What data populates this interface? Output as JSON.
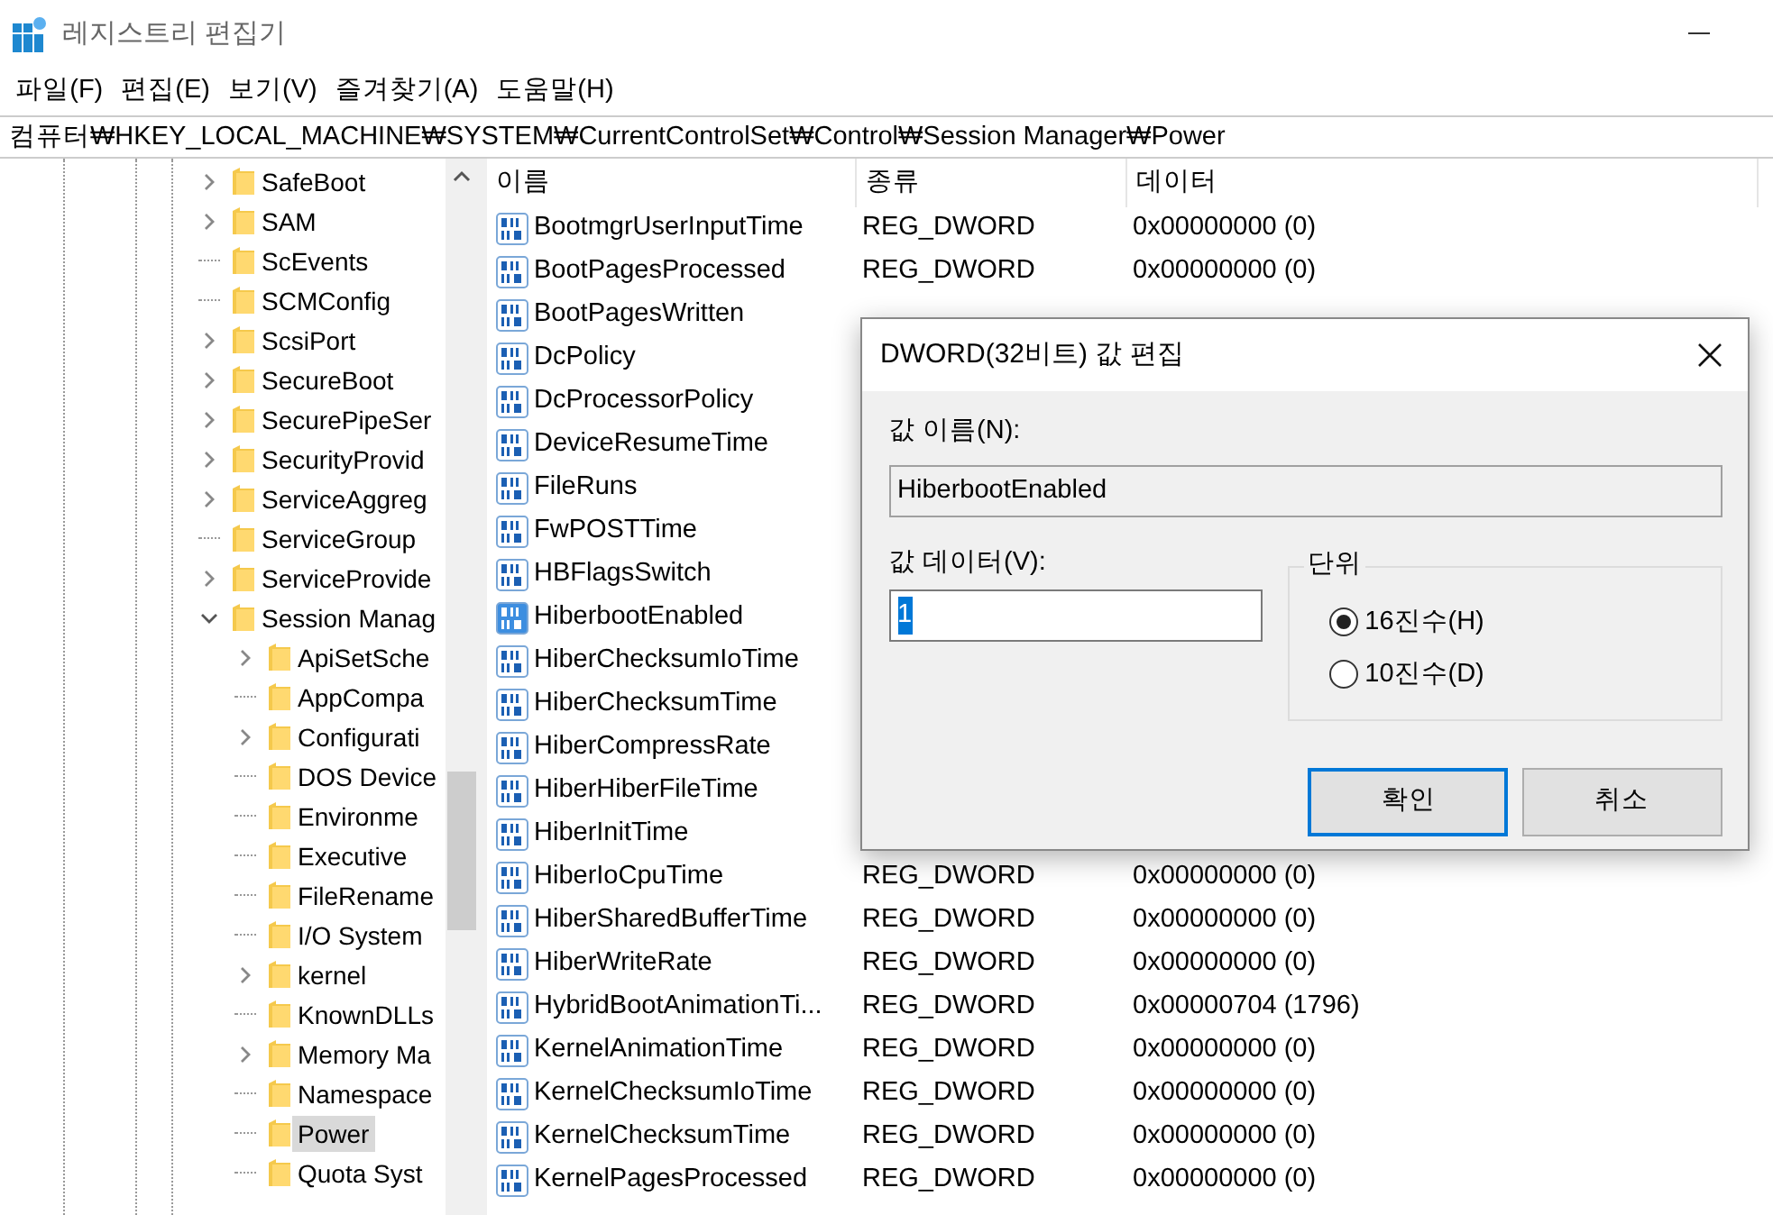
{
  "window": {
    "title": "레지스트리 편집기"
  },
  "menu": [
    "파일(F)",
    "편집(E)",
    "보기(V)",
    "즐겨찾기(A)",
    "도움말(H)"
  ],
  "address": "컴퓨터₩HKEY_LOCAL_MACHINE₩SYSTEM₩CurrentControlSet₩Control₩Session Manager₩Power",
  "tree": [
    {
      "label": "SafeBoot",
      "expandable": true,
      "expanded": false,
      "selected": false
    },
    {
      "label": "SAM",
      "expandable": true,
      "expanded": false,
      "selected": false
    },
    {
      "label": "ScEvents",
      "expandable": false,
      "selected": false
    },
    {
      "label": "SCMConfig",
      "expandable": false,
      "selected": false
    },
    {
      "label": "ScsiPort",
      "expandable": true,
      "expanded": false,
      "selected": false
    },
    {
      "label": "SecureBoot",
      "expandable": true,
      "expanded": false,
      "selected": false
    },
    {
      "label": "SecurePipeSer",
      "expandable": true,
      "expanded": false,
      "selected": false
    },
    {
      "label": "SecurityProvid",
      "expandable": true,
      "expanded": false,
      "selected": false
    },
    {
      "label": "ServiceAggreg",
      "expandable": true,
      "expanded": false,
      "selected": false
    },
    {
      "label": "ServiceGroup",
      "expandable": false,
      "selected": false
    },
    {
      "label": "ServiceProvide",
      "expandable": true,
      "expanded": false,
      "selected": false
    },
    {
      "label": "Session Manag",
      "expandable": true,
      "expanded": true,
      "selected": false,
      "children": [
        {
          "label": "ApiSetSche",
          "expandable": true,
          "expanded": false,
          "selected": false
        },
        {
          "label": "AppCompa",
          "expandable": false,
          "selected": false
        },
        {
          "label": "Configurati",
          "expandable": true,
          "expanded": false,
          "selected": false
        },
        {
          "label": "DOS Device",
          "expandable": false,
          "selected": false
        },
        {
          "label": "Environme",
          "expandable": false,
          "selected": false
        },
        {
          "label": "Executive",
          "expandable": false,
          "selected": false
        },
        {
          "label": "FileRename",
          "expandable": false,
          "selected": false
        },
        {
          "label": "I/O System",
          "expandable": false,
          "selected": false
        },
        {
          "label": "kernel",
          "expandable": true,
          "expanded": false,
          "selected": false
        },
        {
          "label": "KnownDLLs",
          "expandable": false,
          "selected": false
        },
        {
          "label": "Memory Ma",
          "expandable": true,
          "expanded": false,
          "selected": false
        },
        {
          "label": "Namespace",
          "expandable": false,
          "selected": false
        },
        {
          "label": "Power",
          "expandable": false,
          "selected": true
        },
        {
          "label": "Quota Syst",
          "expandable": false,
          "selected": false
        }
      ]
    }
  ],
  "table": {
    "columns": [
      "이름",
      "종류",
      "데이터"
    ],
    "rows": [
      {
        "name": "BootmgrUserInputTime",
        "type": "REG_DWORD",
        "data": "0x00000000 (0)",
        "selected": false
      },
      {
        "name": "BootPagesProcessed",
        "type": "REG_DWORD",
        "data": "0x00000000 (0)",
        "selected": false
      },
      {
        "name": "BootPagesWritten",
        "selected": false
      },
      {
        "name": "DcPolicy",
        "selected": false
      },
      {
        "name": "DcProcessorPolicy",
        "selected": false
      },
      {
        "name": "DeviceResumeTime",
        "selected": false
      },
      {
        "name": "FileRuns",
        "selected": false
      },
      {
        "name": "FwPOSTTime",
        "selected": false
      },
      {
        "name": "HBFlagsSwitch",
        "selected": false
      },
      {
        "name": "HiberbootEnabled",
        "selected": true
      },
      {
        "name": "HiberChecksumIoTime",
        "selected": false
      },
      {
        "name": "HiberChecksumTime",
        "selected": false
      },
      {
        "name": "HiberCompressRate",
        "selected": false
      },
      {
        "name": "HiberHiberFileTime",
        "selected": false
      },
      {
        "name": "HiberInitTime",
        "selected": false
      },
      {
        "name": "HiberIoCpuTime",
        "type": "REG_DWORD",
        "data": "0x00000000 (0)",
        "selected": false
      },
      {
        "name": "HiberSharedBufferTime",
        "type": "REG_DWORD",
        "data": "0x00000000 (0)",
        "selected": false
      },
      {
        "name": "HiberWriteRate",
        "type": "REG_DWORD",
        "data": "0x00000000 (0)",
        "selected": false
      },
      {
        "name": "HybridBootAnimationTi...",
        "type": "REG_DWORD",
        "data": "0x00000704 (1796)",
        "selected": false
      },
      {
        "name": "KernelAnimationTime",
        "type": "REG_DWORD",
        "data": "0x00000000 (0)",
        "selected": false
      },
      {
        "name": "KernelChecksumIoTime",
        "type": "REG_DWORD",
        "data": "0x00000000 (0)",
        "selected": false
      },
      {
        "name": "KernelChecksumTime",
        "type": "REG_DWORD",
        "data": "0x00000000 (0)",
        "selected": false
      },
      {
        "name": "KernelPagesProcessed",
        "type": "REG_DWORD",
        "data": "0x00000000 (0)",
        "selected": false
      }
    ]
  },
  "dialog": {
    "title": "DWORD(32비트) 값 편집",
    "name_label": "값 이름(N):",
    "name_value": "HiberbootEnabled",
    "data_label": "값 데이터(V):",
    "data_value": "1",
    "base_label": "단위",
    "bases": [
      {
        "label": "16진수(H)",
        "selected": true
      },
      {
        "label": "10진수(D)",
        "selected": false
      }
    ],
    "buttons": [
      {
        "label": "확인",
        "default": true
      },
      {
        "label": "취소",
        "default": false
      }
    ]
  }
}
